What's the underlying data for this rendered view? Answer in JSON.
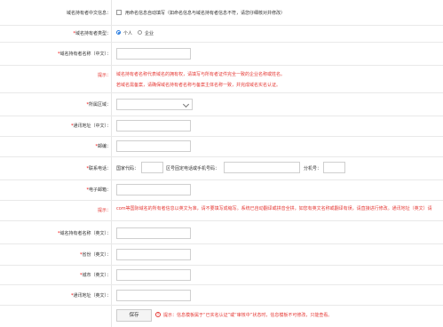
{
  "rows": {
    "chinese_info": {
      "label": "域名持有者中文信息：",
      "checkbox_text": "用命名信息自动填写（如命名信息与域名持有者信息不符，请您仔细核对并修改）"
    },
    "holder_type": {
      "label": "域名持有者类型：",
      "options": [
        "个人",
        "企业"
      ],
      "selected": "个人"
    },
    "holder_name_cn": {
      "label": "域名持有者名称（中文）：",
      "value": ""
    },
    "tip1": {
      "label": "提示：",
      "lines": [
        "域名持有者名称代表域名的拥有权，请填写与所有者证件完全一致的企业名称或姓名。",
        "若域名需备案，请确保域名持有者名称与备案主体名称一致，并完成域名实名认证。"
      ]
    },
    "region": {
      "label": "所属区域：",
      "value": ""
    },
    "address_cn": {
      "label": "通讯地址（中文）：",
      "value": ""
    },
    "postcode": {
      "label": "邮编：",
      "value": ""
    },
    "phone": {
      "label": "联系电话：",
      "country_code": "国家代码：",
      "area_phone": "区号固定电话或手机号码：",
      "ext": "分机号："
    },
    "email": {
      "label": "电子邮箱：",
      "value": ""
    },
    "tip2": {
      "label": "提示：",
      "text": "com等国际域名的所有者信息以英文为准，请不要填写成缩写。系统已自动翻译或拼音全拼，如您有英文名称或翻译有误，请直接进行修改。通讯地址（英文）请"
    },
    "holder_name_en": {
      "label": "域名持有者名称（英文）：",
      "value": ""
    },
    "province_en": {
      "label": "省份（英文）：",
      "value": ""
    },
    "city_en": {
      "label": "城市（英文）：",
      "value": ""
    },
    "address_en": {
      "label": "通讯地址（英文）：",
      "value": ""
    }
  },
  "save": {
    "label": "保存",
    "warning": "提示：信息模板属于“已实名认证”或“审核中”状态时，信息模板不可修改，只能查看。"
  },
  "colors": {
    "accent": "#2a7de1",
    "warning": "#e53935",
    "required": "#e00000"
  }
}
